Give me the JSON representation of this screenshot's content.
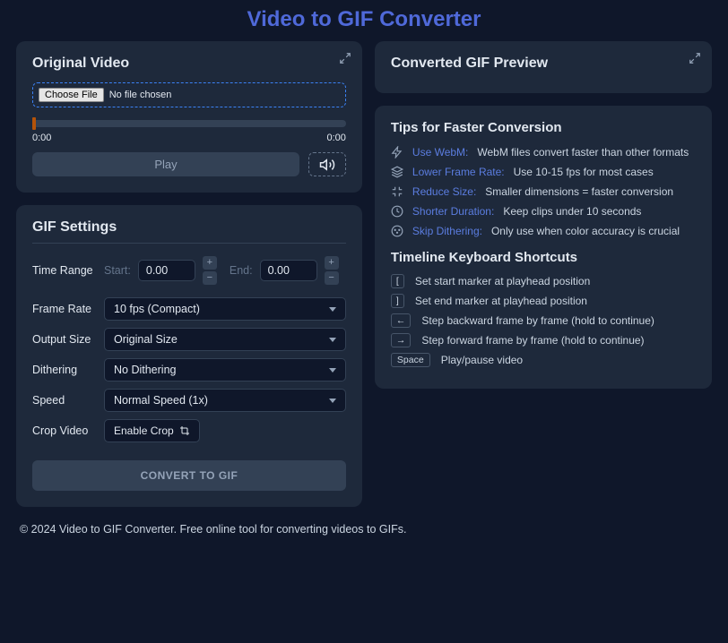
{
  "page_title": "Video to GIF Converter",
  "original_video": {
    "title": "Original Video",
    "choose_file": "Choose File",
    "no_file": "No file chosen",
    "time_start": "0:00",
    "time_end": "0:00",
    "play": "Play"
  },
  "settings": {
    "title": "GIF Settings",
    "time_range_label": "Time Range",
    "start_label": "Start:",
    "start_value": "0.00",
    "end_label": "End:",
    "end_value": "0.00",
    "frame_rate_label": "Frame Rate",
    "frame_rate_value": "10 fps (Compact)",
    "output_size_label": "Output Size",
    "output_size_value": "Original Size",
    "dithering_label": "Dithering",
    "dithering_value": "No Dithering",
    "speed_label": "Speed",
    "speed_value": "Normal Speed (1x)",
    "crop_label": "Crop Video",
    "crop_button": "Enable Crop",
    "convert": "CONVERT TO GIF",
    "plus": "+",
    "minus": "−"
  },
  "preview": {
    "title": "Converted GIF Preview"
  },
  "tips": {
    "title": "Tips for Faster Conversion",
    "items": [
      {
        "label": "Use WebM:",
        "text": "WebM files convert faster than other formats"
      },
      {
        "label": "Lower Frame Rate:",
        "text": "Use 10-15 fps for most cases"
      },
      {
        "label": "Reduce Size:",
        "text": "Smaller dimensions = faster conversion"
      },
      {
        "label": "Shorter Duration:",
        "text": "Keep clips under 10 seconds"
      },
      {
        "label": "Skip Dithering:",
        "text": "Only use when color accuracy is crucial"
      }
    ]
  },
  "shortcuts": {
    "title": "Timeline Keyboard Shortcuts",
    "items": [
      {
        "key": "[",
        "text": "Set start marker at playhead position"
      },
      {
        "key": "]",
        "text": "Set end marker at playhead position"
      },
      {
        "key": "←",
        "text": "Step backward frame by frame (hold to continue)"
      },
      {
        "key": "→",
        "text": "Step forward frame by frame (hold to continue)"
      },
      {
        "key": "Space",
        "text": "Play/pause video"
      }
    ]
  },
  "footer": "© 2024 Video to GIF Converter. Free online tool for converting videos to GIFs."
}
